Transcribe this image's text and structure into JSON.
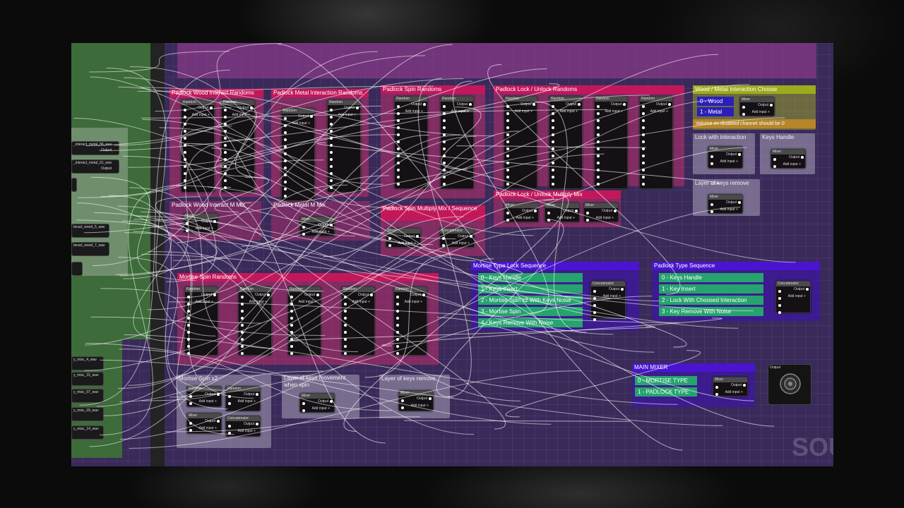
{
  "comments": {
    "padlock_wood_randoms": "Padlock Wood Interact Randoms",
    "padlock_metal_randoms": "Padlock Metal Interaction Randoms",
    "padlock_spin_randoms": "Padlock Spin Randoms",
    "padlock_lock_randoms": "Padlock Lock / Unlock Randoms",
    "wood_metal_choose": "Wood / Metal Interaction Choose",
    "wood_metal_note": "Volume on disabled channel should be 0",
    "lock_with_interaction": "Lock with interaction",
    "keys_handle": "Keys Handle",
    "layer_keys_remove_top": "Layer of keys remove",
    "padlock_wood_mix": "Padlock Wood Interact M Mix",
    "padlock_metal_mix": "Padlock Metal M Mix",
    "padlock_spin_mix": "Padlock Spin Multiply Mix / Sequence",
    "padlock_lock_mix": "Padlock Lock / Unlock Multiply Mix",
    "mortise_spin_randoms": "Mortise Spin Randoms",
    "mortise_type_seq": "Mortise Type Lock Sequence",
    "padlock_type_seq": "Padlock Type Sequence",
    "mortise_spin_x2": "Mortise Spin x2",
    "layer_keys_movement": "Layer of keys movement when spin",
    "layer_keys_remove_bottom": "Layer of keys remove",
    "main_mixer": "MAIN MIXER"
  },
  "wood_metal_options": [
    "0 - Wood",
    "1 - Metal"
  ],
  "mortise_sequence": [
    "0 - Keys Handle",
    "1 - Keys Insert",
    "2 - Mortise Spin x2 With Keys Noise",
    "3 - Mortise Spin",
    "4 - Keys Remove With Noise"
  ],
  "padlock_sequence": [
    "0 - Keys Handle",
    "1 - Key Insert",
    "2 - Lock With Choosed Interaction",
    "3 - Key Remove With Noise"
  ],
  "main_mixer_inputs": [
    "0 - MORTISE TYPE",
    "1 - PADLOCK TYPE"
  ],
  "node_labels": {
    "random": "Random",
    "mixer": "Mixer",
    "concatenator": "Concatenator",
    "output": "Output",
    "add_input": "Add input +",
    "final_output": "Output"
  },
  "wave_nodes": [
    "_interact_metal_06_wav",
    "_interact_metal_01_wav",
    "teract_wood_5_wav",
    "teract_wood_7_wav",
    "y_misc_4_wav",
    "y_misc_15_wav",
    "y_misc_07_wav",
    "y_misc_09_wav",
    "y_misc_14_wav"
  ],
  "watermark": "SOU"
}
